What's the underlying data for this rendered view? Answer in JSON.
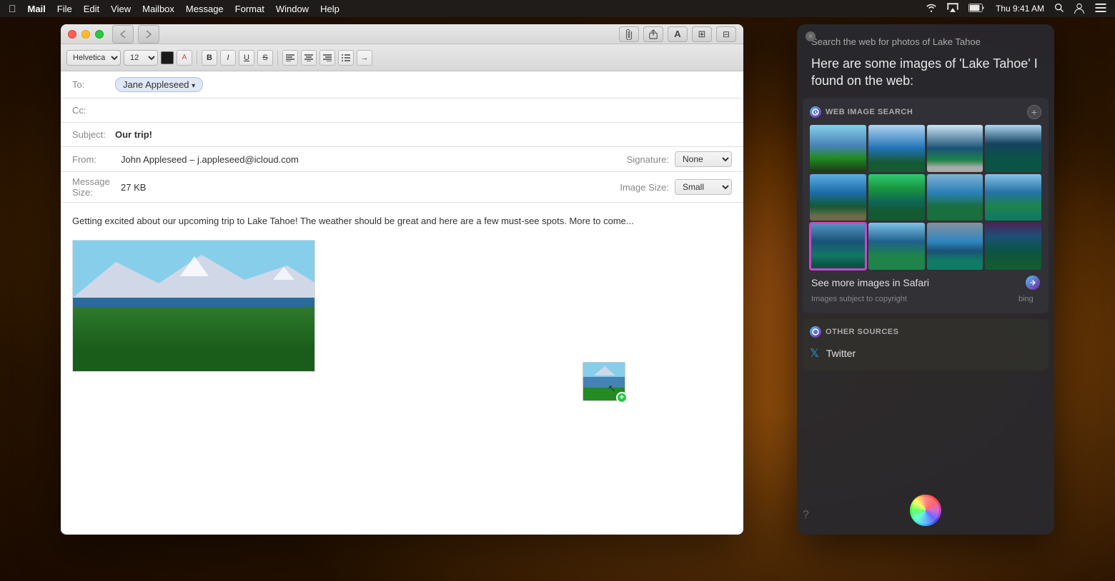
{
  "menubar": {
    "apple": "􀣺",
    "items": [
      "Mail",
      "File",
      "Edit",
      "View",
      "Mailbox",
      "Message",
      "Format",
      "Window",
      "Help"
    ],
    "right": {
      "wifi": "wifi",
      "airplay": "airplay",
      "battery": "battery",
      "datetime": "Thu 9:41 AM",
      "search": "search",
      "user": "user",
      "menu": "menu"
    }
  },
  "mail_window": {
    "to_label": "To:",
    "to_value": "Jane Appleseed",
    "cc_label": "Cc:",
    "subject_label": "Subject:",
    "subject_value": "Our trip!",
    "from_label": "From:",
    "from_value": "John Appleseed – j.appleseed@icloud.com",
    "signature_label": "Signature:",
    "signature_value": "None",
    "message_size_label": "Message Size:",
    "message_size_value": "27 KB",
    "image_size_label": "Image Size:",
    "image_size_value": "Small",
    "body_text": "Getting excited about our upcoming trip to Lake Tahoe! The weather should be great and here are a few must-see spots. More to come...",
    "font_name": "Helvetica",
    "font_size": "12"
  },
  "toolbar": {
    "back_btn": "◀",
    "forward_btn": "▶",
    "paperclip": "📎",
    "share": "⬆",
    "text_btn": "A",
    "photo_btn": "🖼",
    "table_btn": "⊞"
  },
  "siri": {
    "query": "Search the web for photos of Lake Tahoe",
    "response": "Here are some images of 'Lake Tahoe' I found on the web:",
    "section_title": "WEB IMAGE SEARCH",
    "see_more_text": "See more images in Safari",
    "copyright_text": "Images subject to copyright",
    "bing_text": "bing",
    "other_sources_title": "OTHER SOURCES",
    "twitter_label": "Twitter"
  }
}
